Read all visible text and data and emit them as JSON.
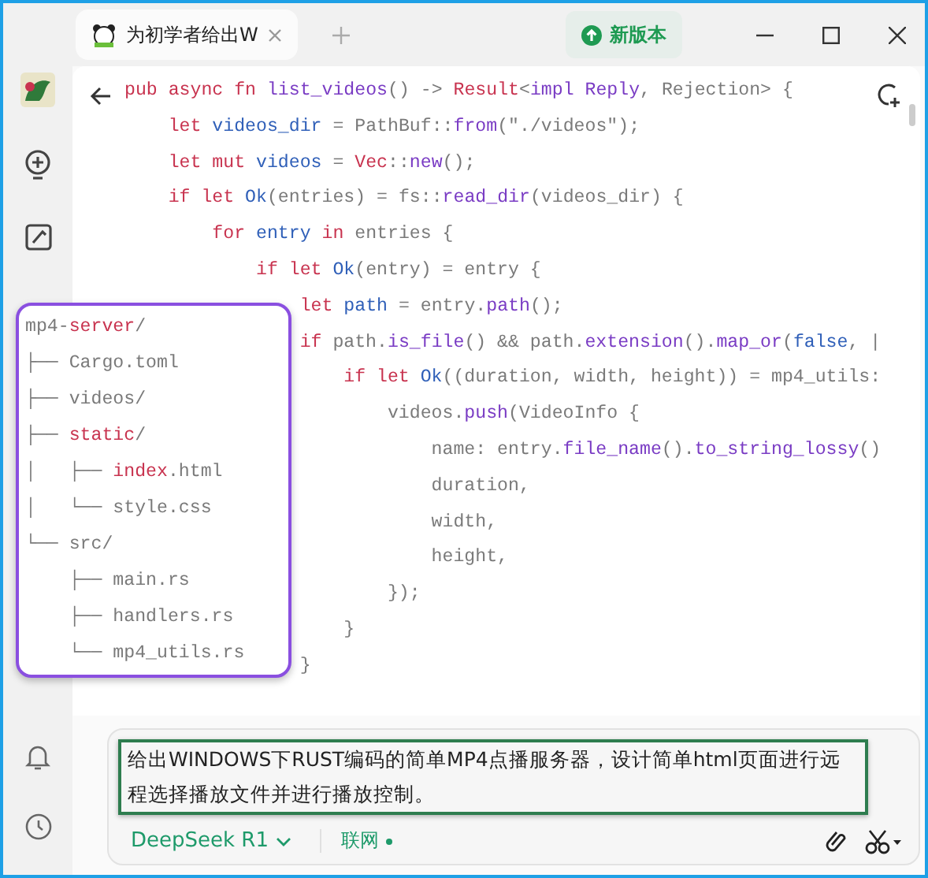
{
  "tab": {
    "title": "为初学者给出W"
  },
  "update_button": {
    "label": "新版本"
  },
  "code_lines": [
    {
      "tokens": [
        {
          "text": "pub async fn ",
          "kind": "kw"
        },
        {
          "text": "list_videos",
          "kind": "fn"
        },
        {
          "text": "() -> ",
          "kind": "plain"
        },
        {
          "text": "Result",
          "kind": "kw"
        },
        {
          "text": "<",
          "kind": "plain"
        },
        {
          "text": "impl Reply",
          "kind": "fn"
        },
        {
          "text": ", Rejection> {",
          "kind": "plain"
        }
      ],
      "children": [
        {
          "tokens": [
            {
              "text": "let ",
              "kind": "kw"
            },
            {
              "text": "videos_dir",
              "kind": "var"
            },
            {
              "text": " = PathBuf::",
              "kind": "plain"
            },
            {
              "text": "from",
              "kind": "fn"
            },
            {
              "text": "(\"./videos\");",
              "kind": "plain"
            }
          ]
        },
        {
          "tokens": [
            {
              "text": "let mut ",
              "kind": "kw"
            },
            {
              "text": "videos",
              "kind": "var"
            },
            {
              "text": " = ",
              "kind": "plain"
            },
            {
              "text": "Vec",
              "kind": "kw"
            },
            {
              "text": "::",
              "kind": "plain"
            },
            {
              "text": "new",
              "kind": "fn"
            },
            {
              "text": "();",
              "kind": "plain"
            }
          ]
        },
        {
          "tokens": [
            {
              "text": "if let ",
              "kind": "kw"
            },
            {
              "text": "Ok",
              "kind": "var"
            },
            {
              "text": "(entries) = fs::",
              "kind": "plain"
            },
            {
              "text": "read_dir",
              "kind": "fn"
            },
            {
              "text": "(videos_dir) {",
              "kind": "plain"
            }
          ],
          "children": [
            {
              "tokens": [
                {
                  "text": "for ",
                  "kind": "kw"
                },
                {
                  "text": "entry",
                  "kind": "var"
                },
                {
                  "text": " in ",
                  "kind": "kw"
                },
                {
                  "text": "entries {",
                  "kind": "plain"
                }
              ],
              "children": [
                {
                  "tokens": [
                    {
                      "text": "if let ",
                      "kind": "kw"
                    },
                    {
                      "text": "Ok",
                      "kind": "var"
                    },
                    {
                      "text": "(entry) = entry {",
                      "kind": "plain"
                    }
                  ],
                  "children": [
                    {
                      "tokens": [
                        {
                          "text": "let ",
                          "kind": "kw"
                        },
                        {
                          "text": "path",
                          "kind": "var"
                        },
                        {
                          "text": " = entry.",
                          "kind": "plain"
                        },
                        {
                          "text": "path",
                          "kind": "fn"
                        },
                        {
                          "text": "();",
                          "kind": "plain"
                        }
                      ]
                    },
                    {
                      "tokens": [
                        {
                          "text": "if ",
                          "kind": "kw"
                        },
                        {
                          "text": "path.",
                          "kind": "plain"
                        },
                        {
                          "text": "is_file",
                          "kind": "fn"
                        },
                        {
                          "text": "() && path.",
                          "kind": "plain"
                        },
                        {
                          "text": "extension",
                          "kind": "fn"
                        },
                        {
                          "text": "().",
                          "kind": "plain"
                        },
                        {
                          "text": "map_or",
                          "kind": "fn"
                        },
                        {
                          "text": "(",
                          "kind": "plain"
                        },
                        {
                          "text": "false",
                          "kind": "var"
                        },
                        {
                          "text": ", |",
                          "kind": "plain"
                        }
                      ],
                      "children": [
                        {
                          "tokens": [
                            {
                              "text": "if let ",
                              "kind": "kw"
                            },
                            {
                              "text": "Ok",
                              "kind": "var"
                            },
                            {
                              "text": "((duration, width, height)) = mp4_utils:",
                              "kind": "plain"
                            }
                          ],
                          "children": [
                            {
                              "tokens": [
                                {
                                  "text": "videos.",
                                  "kind": "plain"
                                },
                                {
                                  "text": "push",
                                  "kind": "fn"
                                },
                                {
                                  "text": "(VideoInfo {",
                                  "kind": "plain"
                                }
                              ],
                              "children": [
                                {
                                  "tokens": [
                                    {
                                      "text": "name: entry.",
                                      "kind": "plain"
                                    },
                                    {
                                      "text": "file_name",
                                      "kind": "fn"
                                    },
                                    {
                                      "text": "().",
                                      "kind": "plain"
                                    },
                                    {
                                      "text": "to_string_lossy",
                                      "kind": "fn"
                                    },
                                    {
                                      "text": "()",
                                      "kind": "plain"
                                    }
                                  ]
                                },
                                {
                                  "tokens": [
                                    {
                                      "text": "duration,",
                                      "kind": "plain"
                                    }
                                  ]
                                },
                                {
                                  "tokens": [
                                    {
                                      "text": "width,",
                                      "kind": "plain"
                                    }
                                  ]
                                },
                                {
                                  "tokens": [
                                    {
                                      "text": "height,",
                                      "kind": "plain"
                                    }
                                  ]
                                }
                              ]
                            },
                            {
                              "tokens": [
                                {
                                  "text": "});",
                                  "kind": "plain"
                                }
                              ]
                            }
                          ]
                        },
                        {
                          "tokens": [
                            {
                              "text": "}",
                              "kind": "plain"
                            }
                          ]
                        }
                      ]
                    },
                    {
                      "tokens": [
                        {
                          "text": "}",
                          "kind": "plain"
                        }
                      ]
                    }
                  ]
                }
              ]
            }
          ]
        }
      ]
    }
  ],
  "file_tree": [
    [
      {
        "text": "mp4-",
        "kind": "plain"
      },
      {
        "text": "server",
        "kind": "kw"
      },
      {
        "text": "/",
        "kind": "plain"
      }
    ],
    [
      {
        "text": "├── Cargo.toml",
        "kind": "plain"
      }
    ],
    [
      {
        "text": "├── videos/",
        "kind": "plain"
      }
    ],
    [
      {
        "text": "├── ",
        "kind": "plain"
      },
      {
        "text": "static",
        "kind": "kw"
      },
      {
        "text": "/",
        "kind": "plain"
      }
    ],
    [
      {
        "text": "│   ├── ",
        "kind": "plain"
      },
      {
        "text": "index",
        "kind": "kw"
      },
      {
        "text": ".html",
        "kind": "plain"
      }
    ],
    [
      {
        "text": "│   └── style.css",
        "kind": "plain"
      }
    ],
    [
      {
        "text": "└── src/",
        "kind": "plain"
      }
    ],
    [
      {
        "text": "    ├── main.rs",
        "kind": "plain"
      }
    ],
    [
      {
        "text": "    ├── handlers.rs",
        "kind": "plain"
      }
    ],
    [
      {
        "text": "    └── mp4_utils.rs",
        "kind": "plain"
      }
    ]
  ],
  "prompt": {
    "value": "给出WINDOWS下RUST编码的简单MP4点播服务器，设计简单html页面进行远程选择播放文件并进行播放控制。"
  },
  "model_button": {
    "label": "DeepSeek R1"
  },
  "web_toggle": {
    "label": "联网",
    "on": true
  }
}
